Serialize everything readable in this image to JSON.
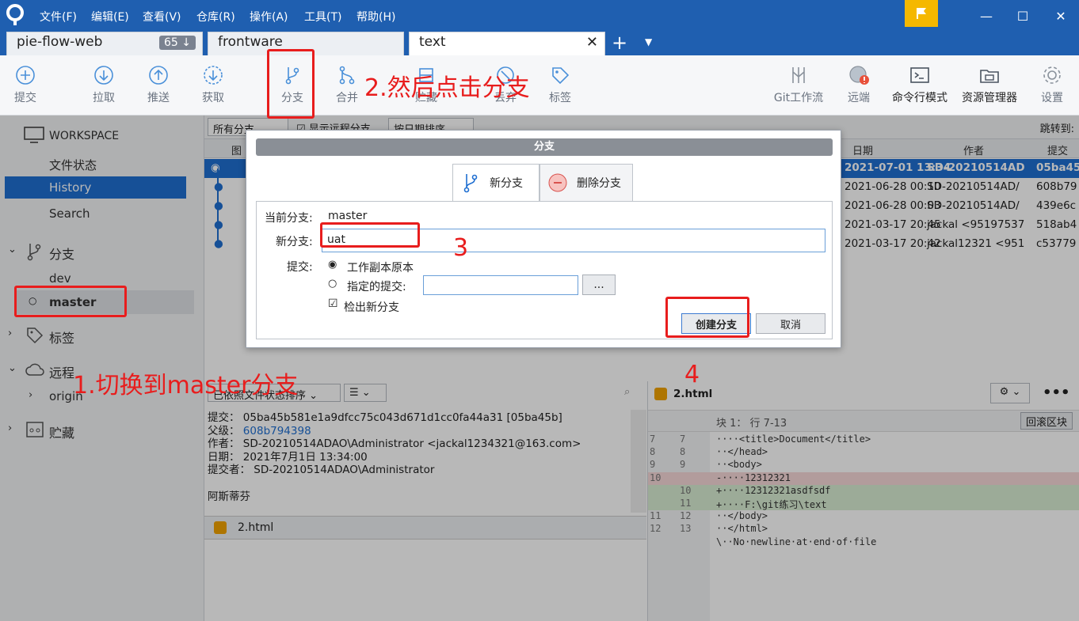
{
  "menu": [
    "文件(F)",
    "编辑(E)",
    "查看(V)",
    "仓库(R)",
    "操作(A)",
    "工具(T)",
    "帮助(H)"
  ],
  "tabs": [
    {
      "label": "pie-flow-web",
      "badge": "65 ↓"
    },
    {
      "label": "frontware"
    },
    {
      "label": "text"
    }
  ],
  "toolbar": {
    "commit": "提交",
    "pull": "拉取",
    "push": "推送",
    "fetch": "获取",
    "branch": "分支",
    "merge": "合并",
    "stash": "贮藏",
    "discard": "丢弃",
    "tag": "标签",
    "gitflow": "Git工作流",
    "remote": "远端",
    "terminal": "命令行模式",
    "explorer": "资源管理器",
    "settings": "设置"
  },
  "sidebar": {
    "workspace": "WORKSPACE",
    "file_status": "文件状态",
    "history": "History",
    "search": "Search",
    "branches": "分支",
    "dev": "dev",
    "master": "master",
    "tags": "标签",
    "remotes": "远程",
    "origin": "origin",
    "stashes": "贮藏"
  },
  "list": {
    "filter_all": "所有分支",
    "show_remote": "显示远程分支",
    "sort": "按日期排序",
    "jump": "跳转到:",
    "col_graph": "图",
    "col_date": "日期",
    "col_author": "作者",
    "col_commit": "提交",
    "rows": [
      {
        "date": "2021-07-01 13:34",
        "author": "SD-20210514AD",
        "hash": "05ba45"
      },
      {
        "date": "2021-06-28 00:10",
        "author": "SD-20210514AD/",
        "hash": "608b79"
      },
      {
        "date": "2021-06-28 00:03",
        "author": "SD-20210514AD/",
        "hash": "439e6c"
      },
      {
        "date": "2021-03-17 20:45",
        "author": "jackal <95197537",
        "hash": "518ab4"
      },
      {
        "date": "2021-03-17 20:42",
        "author": "jackal12321 <951",
        "hash": "c53779"
      }
    ]
  },
  "detail": {
    "sort": "已依照文件状态排序",
    "commit_k": "提交：",
    "commit_v": "05ba45b581e1a9dfcc75c043d671d1cc0fa44a31 [05ba45b]",
    "parent_k": "父级：",
    "parent_v": "608b794398",
    "author_k": "作者：",
    "author_v": "SD-20210514ADAO\\Administrator <jackal1234321@163.com>",
    "date_k": "日期：",
    "date_v": "2021年7月1日 13:34:00",
    "committer_k": "提交者：",
    "committer_v": "SD-20210514ADAO\\Administrator",
    "message": "阿斯蒂芬",
    "file": "2.html"
  },
  "diff": {
    "file": "2.html",
    "hunk": "块 1： 行 7-13",
    "rollback": "回滚区块",
    "lines": [
      {
        "o": "7",
        "n": "7",
        "t": "····<title>Document</title>",
        "k": "ctx"
      },
      {
        "o": "8",
        "n": "8",
        "t": "··</head>",
        "k": "ctx"
      },
      {
        "o": "9",
        "n": "9",
        "t": "··<body>",
        "k": "ctx"
      },
      {
        "o": "10",
        "n": "",
        "t": "-····12312321",
        "k": "del"
      },
      {
        "o": "",
        "n": "10",
        "t": "+····12312321asdfsdf",
        "k": "add"
      },
      {
        "o": "",
        "n": "11",
        "t": "+····F:\\git练习\\text",
        "k": "add"
      },
      {
        "o": "11",
        "n": "12",
        "t": "··</body>",
        "k": "ctx"
      },
      {
        "o": "12",
        "n": "13",
        "t": "··</html>",
        "k": "ctx"
      },
      {
        "o": "",
        "n": "",
        "t": "\\··No·newline·at·end·of·file",
        "k": "ctx"
      }
    ]
  },
  "dialog": {
    "title": "分支",
    "tab_new": "新分支",
    "tab_delete": "删除分支",
    "current_k": "当前分支:",
    "current_v": "master",
    "new_k": "新分支:",
    "new_v": "uat",
    "commit_k": "提交:",
    "opt_working": "工作副本原本",
    "opt_specified": "指定的提交:",
    "browse": "...",
    "checkout": "检出新分支",
    "create": "创建分支",
    "cancel": "取消"
  },
  "annotations": {
    "a1": "1.切换到master分支",
    "a2": "2.然后点击分支",
    "a3": "3",
    "a4": "4"
  },
  "colors": {
    "brand": "#1f5fb0",
    "selection": "#1f6fd1",
    "annotation": "#e81d1d"
  }
}
